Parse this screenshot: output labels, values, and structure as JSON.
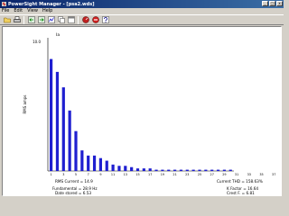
{
  "window": {
    "title": "PowerSight Manager - [psa2.wds]",
    "controls": [
      "_",
      "□",
      "x"
    ]
  },
  "menu": [
    "File",
    "Edit",
    "View",
    "Help"
  ],
  "toolbar": [
    "open-icon",
    "print-icon",
    "back-icon",
    "forward-icon",
    "graph-icon",
    "copy-icon",
    "window-icon",
    "meter-icon",
    "stop-icon",
    "help-icon"
  ],
  "chart_data": {
    "type": "bar",
    "series": [
      {
        "name": "Ia",
        "values": [
          8.7,
          7.7,
          6.5,
          4.7,
          3.1,
          1.6,
          1.2,
          1.2,
          1.0,
          0.8,
          0.5,
          0.4,
          0.4,
          0.3,
          0.2,
          0.2,
          0.2,
          0.1,
          0.1,
          0.1,
          0.1,
          0.1,
          0.1,
          0.1,
          0.1,
          0.1,
          0.1,
          0.1,
          0.1,
          0.1
        ]
      }
    ],
    "ylabel": "RMS amps",
    "ylim": [
      0,
      10
    ],
    "ytick_top": "10.0",
    "xticks": [
      "1",
      "3",
      "5",
      "7",
      "9",
      "11",
      "13",
      "15",
      "17",
      "19",
      "21",
      "23",
      "25",
      "27",
      "29",
      "31",
      "33",
      "35",
      "37",
      "39",
      "41",
      "43",
      "45",
      "47",
      "49"
    ],
    "grid": false,
    "color": "#1f1fd0"
  },
  "stats": {
    "rms_current": "RMS Current = 14.9",
    "current_thd": "Current THD = 158.63%",
    "fundamental": "Fundamental = 28.9 Hz",
    "k_factor": "K Factor = 16.64",
    "date_stored": "Date stored = 6.53",
    "crest_factor": "Crest F. = 6.81"
  }
}
